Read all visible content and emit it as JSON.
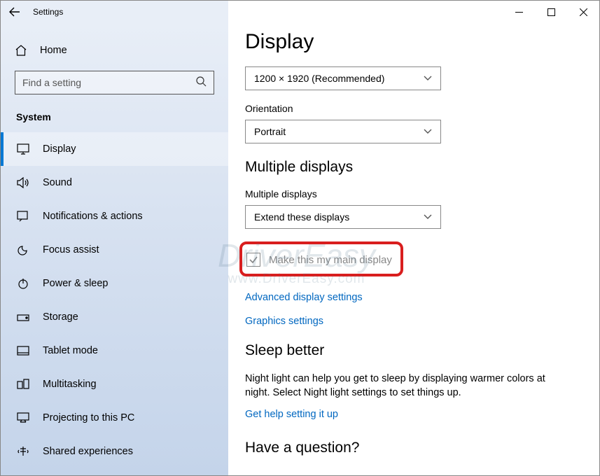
{
  "window": {
    "title": "Settings"
  },
  "sidebar": {
    "home_label": "Home",
    "search_placeholder": "Find a setting",
    "category": "System",
    "items": [
      {
        "label": "Display",
        "icon": "display-icon",
        "selected": true
      },
      {
        "label": "Sound",
        "icon": "sound-icon"
      },
      {
        "label": "Notifications & actions",
        "icon": "notifications-icon"
      },
      {
        "label": "Focus assist",
        "icon": "focus-icon"
      },
      {
        "label": "Power & sleep",
        "icon": "power-icon"
      },
      {
        "label": "Storage",
        "icon": "storage-icon"
      },
      {
        "label": "Tablet mode",
        "icon": "tablet-icon"
      },
      {
        "label": "Multitasking",
        "icon": "multitasking-icon"
      },
      {
        "label": "Projecting to this PC",
        "icon": "projecting-icon"
      },
      {
        "label": "Shared experiences",
        "icon": "shared-icon"
      }
    ]
  },
  "main": {
    "title": "Display",
    "resolution": "1200 × 1920 (Recommended)",
    "orientation_label": "Orientation",
    "orientation_value": "Portrait",
    "multi_head": "Multiple displays",
    "multi_label": "Multiple displays",
    "multi_value": "Extend these displays",
    "main_display_label": "Make this my main display",
    "link_advanced": "Advanced display settings",
    "link_graphics": "Graphics settings",
    "sleep_head": "Sleep better",
    "sleep_desc": "Night light can help you get to sleep by displaying warmer colors at night. Select Night light settings to set things up.",
    "link_sleep": "Get help setting it up",
    "question_head": "Have a question?"
  },
  "watermark": {
    "brand": "DriverEasy",
    "url": "www.DriverEasy.com"
  }
}
